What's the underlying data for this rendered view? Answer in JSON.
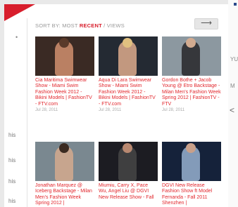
{
  "sidebar": {
    "items": [
      "his",
      "his",
      "his",
      "his"
    ]
  },
  "sort": {
    "prefix": "SORT BY: MOST ",
    "recent": "RECENT",
    "sep": " / ",
    "views": "VIEWS"
  },
  "next_icon": "arrow-right-icon",
  "cards": [
    {
      "title": "Cia Maritima Swimwear Show - Miami Swim Fashion Week 2012 - Bikini Models | FashionTV - FTV.com",
      "date": "Jul 28, 2011"
    },
    {
      "title": "Aqua Di Lara Swimwear Show - Miami Swim Fashion Week 2012 - Bikini Models | FashionTV - FTV.com",
      "date": "Jul 28, 2011"
    },
    {
      "title": "Gordon Bothe + Jacob Young @ Etro Backstage - Milan Men's Fashion Week Spring 2012 | FashionTV - FTV",
      "date": "Jul 28, 2011"
    },
    {
      "title": "Jonathan Marquez @ Iceberg Backstage - Milan Men's Fashion Week Spring 2012 |",
      "date": ""
    },
    {
      "title": "Miumiu, Carry X, Pace Wu, Angel Liu @ DGVI New Release Show - Fall",
      "date": ""
    },
    {
      "title": "DGVI New Release Fashion Show ft Model Fernanda - Fall 2011 Shenzhen |",
      "date": ""
    }
  ],
  "right": {
    "r1": "YU",
    "r2": "M",
    "chev": "<"
  }
}
